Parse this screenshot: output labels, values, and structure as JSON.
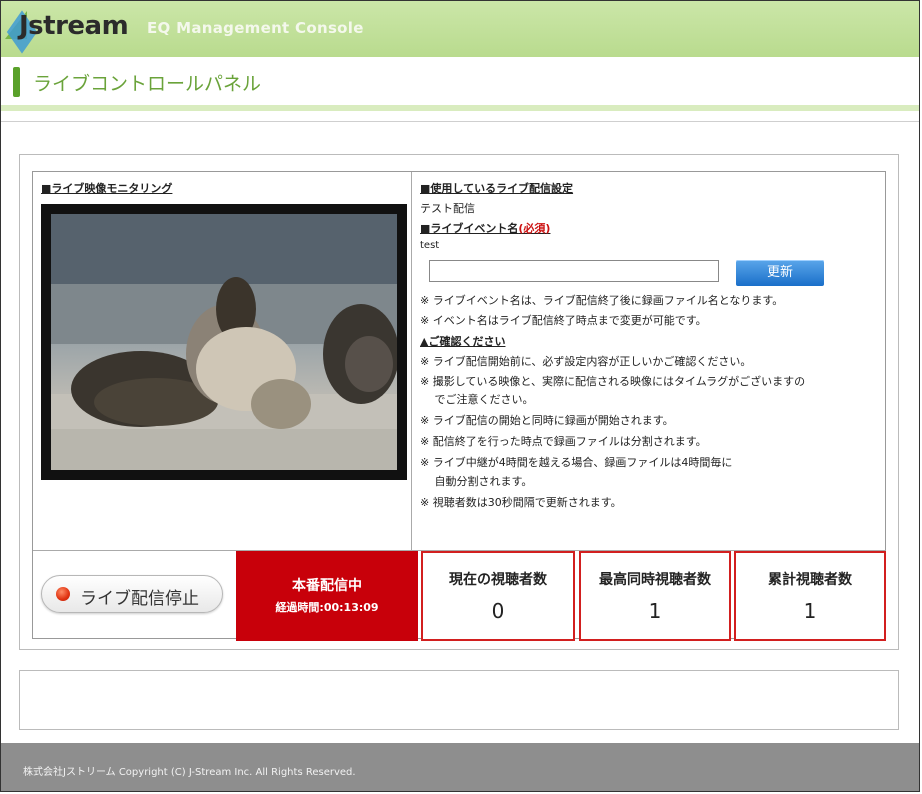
{
  "header": {
    "logo_text": "Jstream",
    "console_title": "EQ Management Console"
  },
  "page": {
    "title": "ライブコントロールパネル"
  },
  "monitor": {
    "heading": "■ライブ映像モニタリング"
  },
  "settings": {
    "heading": "■使用しているライブ配信設定",
    "value": "テスト配信"
  },
  "event": {
    "heading": "■ライブイベント名",
    "required": "(必須)",
    "current_name": "test",
    "input_value": "",
    "update_label": "更新",
    "notes": [
      "※ ライブイベント名は、ライブ配信終了後に録画ファイル名となります。",
      "※ イベント名はライブ配信終了時点まで変更が可能です。"
    ]
  },
  "confirm": {
    "heading": "▲ご確認ください",
    "red_notes": [
      "※ ライブ配信開始前に、必ず設定内容が正しいかご確認ください。",
      "※ 撮影している映像と、実際に配信される映像にはタイムラグがございますの",
      "　 でご注意ください。"
    ],
    "notes": [
      "※ ライブ配信の開始と同時に録画が開始されます。",
      "※ 配信終了を行った時点で録画ファイルは分割されます。",
      "※ ライブ中継が4時間を越える場合、録画ファイルは4時間毎に",
      "　 自動分割されます。",
      "※ 視聴者数は30秒間隔で更新されます。"
    ]
  },
  "controls": {
    "stop_label": "ライブ配信停止",
    "status_label": "本番配信中",
    "elapsed_label": "経過時間:00:13:09"
  },
  "stats": [
    {
      "label": "現在の視聴者数",
      "value": "0"
    },
    {
      "label": "最高同時視聴者数",
      "value": "1"
    },
    {
      "label": "累計視聴者数",
      "value": "1"
    }
  ],
  "footer": {
    "text": "株式会社Jストリーム Copyright (C) J-Stream Inc. All Rights Reserved."
  },
  "colors": {
    "brand_green": "#7ab648",
    "live_red": "#c8000a",
    "button_blue": "#1a6fc9"
  }
}
